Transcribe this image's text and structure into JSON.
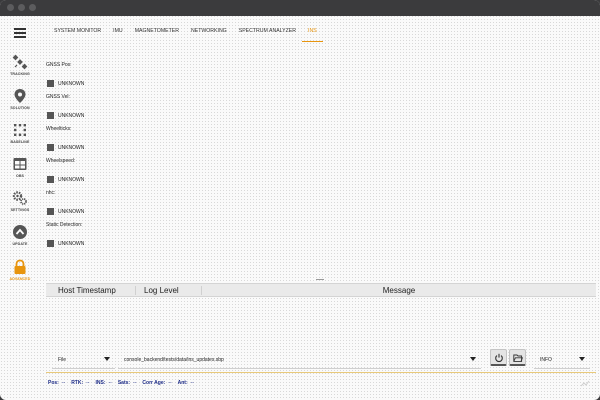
{
  "sidebar": {
    "items": [
      {
        "label": "TRACKING",
        "icon": "satellite-icon"
      },
      {
        "label": "SOLUTION",
        "icon": "map-pin-icon"
      },
      {
        "label": "BASELINE",
        "icon": "dot-grid-icon"
      },
      {
        "label": "OBS",
        "icon": "table-icon"
      },
      {
        "label": "SETTINGS",
        "icon": "gear-icon"
      },
      {
        "label": "UPDATE",
        "icon": "up-arrow-icon"
      },
      {
        "label": "ADVANCED",
        "icon": "lock-icon"
      }
    ],
    "active_color": "#e8950e"
  },
  "tabs": [
    {
      "label": "SYSTEM MONITOR"
    },
    {
      "label": "IMU"
    },
    {
      "label": "MAGNETOMETER"
    },
    {
      "label": "NETWORKING"
    },
    {
      "label": "SPECTRUM ANALYZER"
    },
    {
      "label": "INS"
    }
  ],
  "active_tab": "INS",
  "ins": {
    "fields": [
      {
        "label": "GNSS Pos:",
        "value": "UNKNOWN"
      },
      {
        "label": "GNSS Vel:",
        "value": "UNKNOWN"
      },
      {
        "label": "Wheelticks:",
        "value": "UNKNOWN"
      },
      {
        "label": "Wheelspeed:",
        "value": "UNKNOWN"
      },
      {
        "label": "nhc:",
        "value": "UNKNOWN"
      },
      {
        "label": "Static Detection:",
        "value": "UNKNOWN"
      }
    ]
  },
  "log": {
    "columns": {
      "timestamp": "Host Timestamp",
      "level": "Log Level",
      "message": "Message"
    }
  },
  "connection": {
    "source": "File",
    "file_path": "console_backend/tests/data/ins_updates.sbp",
    "log_level": "INFO"
  },
  "status_bar": {
    "pos_label": "Pos:",
    "pos_value": "--",
    "rtk_label": "RTK:",
    "rtk_value": "--",
    "ins_label": "INS:",
    "ins_value": "--",
    "sats_label": "Sats:",
    "sats_value": "--",
    "corr_label": "Corr Age:",
    "corr_value": "--",
    "ant_label": "Ant:",
    "ant_value": "--"
  }
}
